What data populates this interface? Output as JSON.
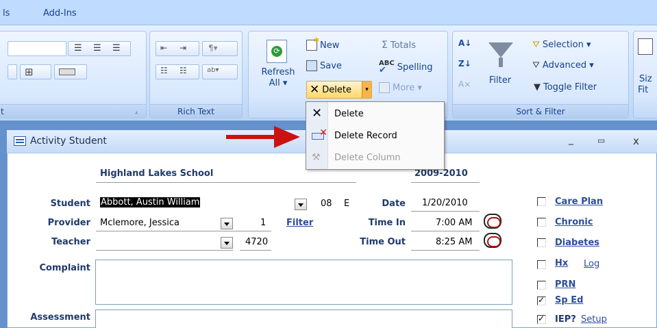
{
  "menu": {
    "tab1": "ls",
    "tab2": "Add-Ins"
  },
  "ribbon": {
    "groups": {
      "font_label": "t",
      "richtext_label": "Rich Text",
      "sortfilter_label": "Sort & Filter"
    },
    "records": {
      "refresh": "Refresh",
      "refresh_sub": "All ▾",
      "new": "New",
      "save": "Save",
      "delete": "Delete",
      "totals": "Totals",
      "spelling": "Spelling",
      "more": "More ▾"
    },
    "sort": {
      "filter": "Filter",
      "selection": "Selection ▾",
      "advanced": "Advanced ▾",
      "toggle_filter": "Toggle Filter"
    },
    "window": {
      "size_fit": "Siz",
      "size_fit2": "Fit"
    }
  },
  "dropdown": {
    "items": [
      {
        "label": "Delete",
        "underline": "D"
      },
      {
        "label": "Delete Record",
        "underline": "R"
      },
      {
        "label": "Delete Column",
        "underline": "m"
      }
    ]
  },
  "form": {
    "title": "Activity Student",
    "school": "Highland Lakes School",
    "year": "2009-2010",
    "student_label": "Student",
    "student_value": "Abbott, Austin William",
    "grade": "08",
    "grade_code": "E",
    "date_label": "Date",
    "date_value": "1/20/2010",
    "provider_label": "Provider",
    "provider_value": "Mclemore, Jessica",
    "provider_num": "1",
    "filter_link": "Filter",
    "timein_label": "Time In",
    "timein_value": "7:00 AM",
    "teacher_label": "Teacher",
    "teacher_num": "4720",
    "timeout_label": "Time Out",
    "timeout_value": "8:25 AM",
    "complaint_label": "Complaint",
    "assessment_label": "Assessment",
    "checks": [
      {
        "label": "Care Plan",
        "checked": false
      },
      {
        "label": "Chronic",
        "checked": false
      },
      {
        "label": "Diabetes",
        "checked": false
      },
      {
        "label": "Hx",
        "checked": false,
        "extra": "Log"
      },
      {
        "label": "PRN",
        "checked": false
      },
      {
        "label": "Sp Ed",
        "checked": true
      },
      {
        "label": "IEP?",
        "checked": true,
        "extra": "Setup"
      }
    ]
  },
  "colors": {
    "ribbon_text": "#15428b",
    "arrow": "#cc1111"
  }
}
